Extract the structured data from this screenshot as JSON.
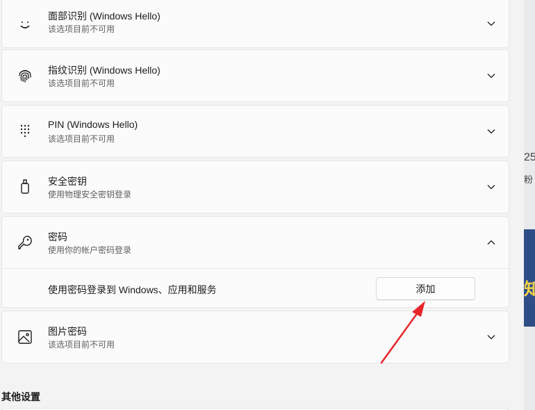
{
  "options": [
    {
      "id": "face",
      "title": "面部识别 (Windows Hello)",
      "subtitle": "该选项目前不可用",
      "icon": "smiley-face-icon",
      "expanded": false
    },
    {
      "id": "fingerprint",
      "title": "指纹识别 (Windows Hello)",
      "subtitle": "该选项目前不可用",
      "icon": "fingerprint-icon",
      "expanded": false
    },
    {
      "id": "pin",
      "title": "PIN (Windows Hello)",
      "subtitle": "该选项目前不可用",
      "icon": "keypad-icon",
      "expanded": false
    },
    {
      "id": "security-key",
      "title": "安全密钥",
      "subtitle": "使用物理安全密钥登录",
      "icon": "usb-key-icon",
      "expanded": false
    },
    {
      "id": "password",
      "title": "密码",
      "subtitle": "使用你的帐户密码登录",
      "icon": "key-icon",
      "expanded": true,
      "expanded_label": "使用密码登录到 Windows、应用和服务",
      "button_label": "添加"
    },
    {
      "id": "picture-password",
      "title": "图片密码",
      "subtitle": "该选项目前不可用",
      "icon": "picture-icon",
      "expanded": false
    }
  ],
  "other_settings_heading": "其他设置",
  "background_fragments": {
    "number": "25",
    "char1": "粉",
    "char2": "知"
  },
  "colors": {
    "card_bg": "#fbfbfb",
    "page_bg": "#f3f3f3",
    "arrow": "#e8242a"
  }
}
